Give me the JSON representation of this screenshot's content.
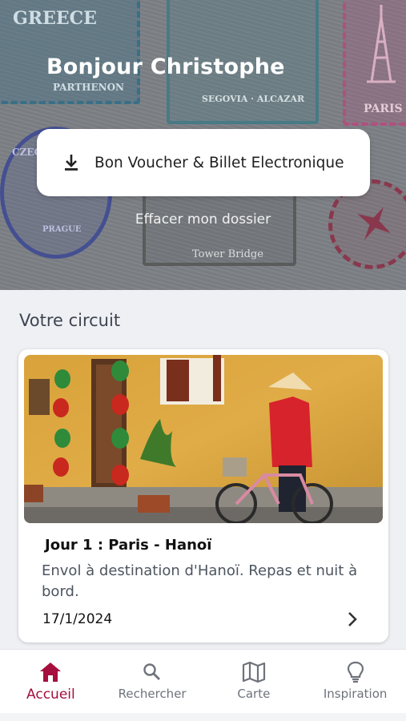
{
  "header": {
    "greeting": "Bonjour Christophe",
    "voucher_button_label": "Bon Voucher & Billet Electronique",
    "voucher_icon": "download-icon",
    "clear_link": "Effacer mon dossier",
    "stamps": {
      "greece": "GREECE",
      "parthenon": "PARTHENON",
      "segovia": "SEGOVIA · ALCAZAR",
      "paris": "PARIS",
      "prague": "PRAGUE",
      "tower_bridge": "Tower Bridge",
      "czech": "CZECH"
    }
  },
  "circuit": {
    "section_title": "Votre circuit",
    "card": {
      "day_title": "Jour 1 : Paris - Hanoï",
      "description": "Envol à destination d'Hanoï. Repas et nuit à bord.",
      "date": "17/1/2024",
      "chevron_icon": "chevron-right-icon"
    }
  },
  "nav": {
    "items": [
      {
        "label": "Accueil",
        "icon": "home-icon",
        "active": true
      },
      {
        "label": "Rechercher",
        "icon": "search-icon",
        "active": false
      },
      {
        "label": "Carte",
        "icon": "map-icon",
        "active": false
      },
      {
        "label": "Inspiration",
        "icon": "lightbulb-icon",
        "active": false
      }
    ]
  },
  "colors": {
    "accent": "#a50e3d",
    "header_bg": "#7d8186",
    "page_bg": "#eef0f4"
  }
}
